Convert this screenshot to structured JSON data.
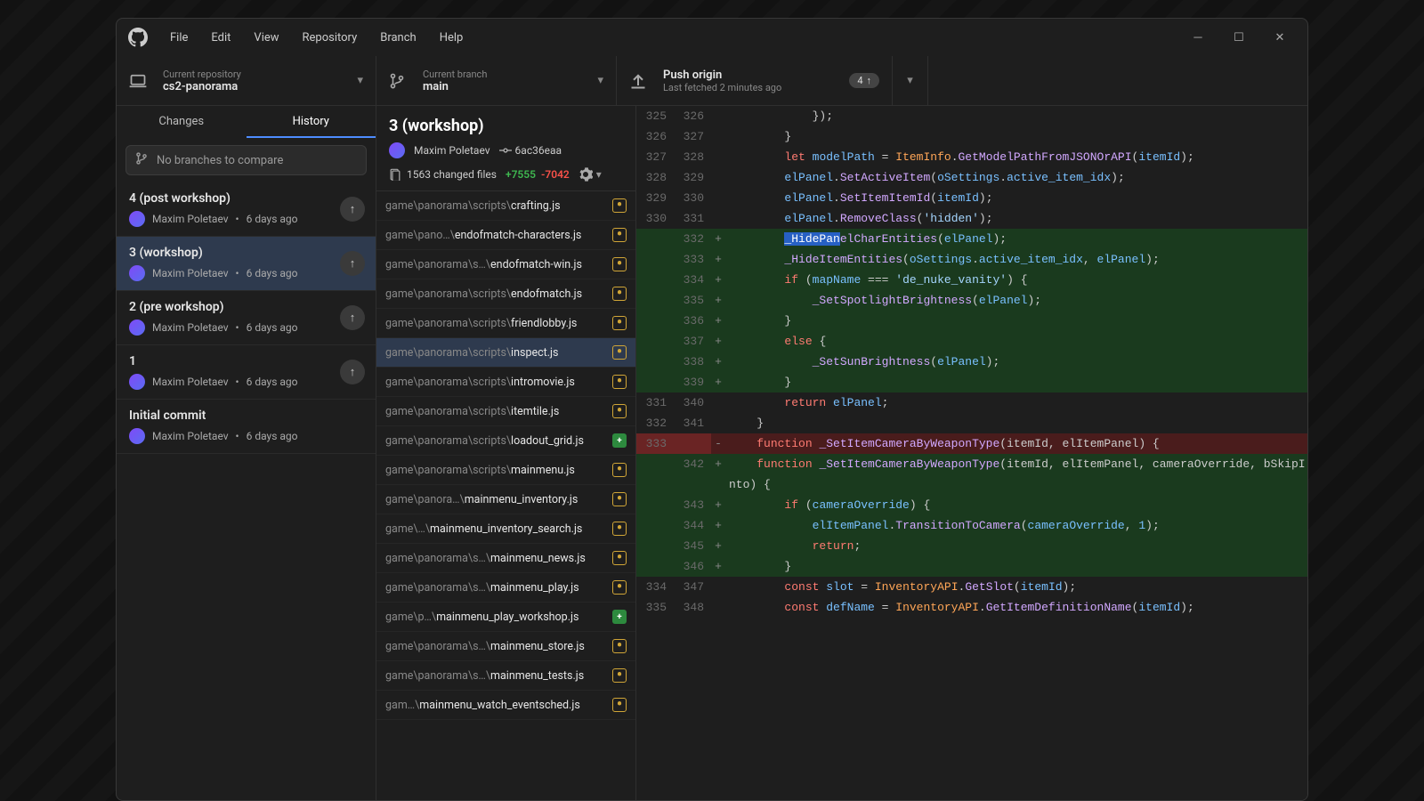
{
  "menus": {
    "file": "File",
    "edit": "Edit",
    "view": "View",
    "repository": "Repository",
    "branch": "Branch",
    "help": "Help"
  },
  "repo": {
    "label": "Current repository",
    "name": "cs2-panorama"
  },
  "branch": {
    "label": "Current branch",
    "name": "main"
  },
  "push": {
    "label": "Push origin",
    "sub": "Last fetched 2 minutes ago",
    "badge": "4"
  },
  "tabs": {
    "changes": "Changes",
    "history": "History"
  },
  "compare_placeholder": "No branches to compare",
  "commits": [
    {
      "title": "4 (post workshop)",
      "author": "Maxim Poletaev",
      "time": "6 days ago",
      "hasUp": true
    },
    {
      "title": "3 (workshop)",
      "author": "Maxim Poletaev",
      "time": "6 days ago",
      "hasUp": true
    },
    {
      "title": "2 (pre workshop)",
      "author": "Maxim Poletaev",
      "time": "6 days ago",
      "hasUp": true
    },
    {
      "title": "1",
      "author": "Maxim Poletaev",
      "time": "6 days ago",
      "hasUp": true
    },
    {
      "title": "Initial commit",
      "author": "Maxim Poletaev",
      "time": "6 days ago",
      "hasUp": false
    }
  ],
  "commit_header": {
    "title": "3 (workshop)",
    "author": "Maxim Poletaev",
    "sha": "6ac36eaa",
    "changed": "1563 changed files",
    "add": "+7555",
    "del": "-7042"
  },
  "files": [
    {
      "pre": "game\\panorama\\scripts\\",
      "name": "crafting.js",
      "t": "mod"
    },
    {
      "pre": "game\\pano…\\",
      "name": "endofmatch-characters.js",
      "t": "mod"
    },
    {
      "pre": "game\\panorama\\s…\\",
      "name": "endofmatch-win.js",
      "t": "mod"
    },
    {
      "pre": "game\\panorama\\scripts\\",
      "name": "endofmatch.js",
      "t": "mod"
    },
    {
      "pre": "game\\panorama\\scripts\\",
      "name": "friendlobby.js",
      "t": "mod"
    },
    {
      "pre": "game\\panorama\\scripts\\",
      "name": "inspect.js",
      "t": "mod"
    },
    {
      "pre": "game\\panorama\\scripts\\",
      "name": "intromovie.js",
      "t": "mod"
    },
    {
      "pre": "game\\panorama\\scripts\\",
      "name": "itemtile.js",
      "t": "mod"
    },
    {
      "pre": "game\\panorama\\scripts\\",
      "name": "loadout_grid.js",
      "t": "add"
    },
    {
      "pre": "game\\panorama\\scripts\\",
      "name": "mainmenu.js",
      "t": "mod"
    },
    {
      "pre": "game\\panora…\\",
      "name": "mainmenu_inventory.js",
      "t": "mod"
    },
    {
      "pre": "game\\…\\",
      "name": "mainmenu_inventory_search.js",
      "t": "mod"
    },
    {
      "pre": "game\\panorama\\s…\\",
      "name": "mainmenu_news.js",
      "t": "mod"
    },
    {
      "pre": "game\\panorama\\s…\\",
      "name": "mainmenu_play.js",
      "t": "mod"
    },
    {
      "pre": "game\\p…\\",
      "name": "mainmenu_play_workshop.js",
      "t": "add"
    },
    {
      "pre": "game\\panorama\\s…\\",
      "name": "mainmenu_store.js",
      "t": "mod"
    },
    {
      "pre": "game\\panorama\\s…\\",
      "name": "mainmenu_tests.js",
      "t": "mod"
    },
    {
      "pre": "gam…\\",
      "name": "mainmenu_watch_eventsched.js",
      "t": "mod"
    }
  ],
  "diff": [
    {
      "o": "325",
      "n": "326",
      "m": "",
      "t": "ctx",
      "html": "            });"
    },
    {
      "o": "326",
      "n": "327",
      "m": "",
      "t": "ctx",
      "html": "        }"
    },
    {
      "o": "327",
      "n": "328",
      "m": "",
      "t": "ctx",
      "html": "        <span class='c-k'>let</span> <span class='c-v'>modelPath</span> = <span class='c-t'>ItemInfo</span>.<span class='c-f'>GetModelPathFromJSONOrAPI</span>(<span class='c-v'>itemId</span>);"
    },
    {
      "o": "328",
      "n": "329",
      "m": "",
      "t": "ctx",
      "html": "        <span class='c-v'>elPanel</span>.<span class='c-f'>SetActiveItem</span>(<span class='c-v'>oSettings</span>.<span class='c-v'>active_item_idx</span>);"
    },
    {
      "o": "329",
      "n": "330",
      "m": "",
      "t": "ctx",
      "html": "        <span class='c-v'>elPanel</span>.<span class='c-f'>SetItemItemId</span>(<span class='c-v'>itemId</span>);"
    },
    {
      "o": "330",
      "n": "331",
      "m": "",
      "t": "ctx",
      "html": "        <span class='c-v'>elPanel</span>.<span class='c-f'>RemoveClass</span>(<span class='c-s'>'hidden'</span>);"
    },
    {
      "o": "",
      "n": "332",
      "m": "+",
      "t": "added hl",
      "html": "        <span class='selmark'>_HidePan</span><span class='c-f'>elCharEntities</span>(<span class='c-v'>elPanel</span>);"
    },
    {
      "o": "",
      "n": "333",
      "m": "+",
      "t": "added",
      "html": "        <span class='c-f'>_HideItemEntities</span>(<span class='c-v'>oSettings</span>.<span class='c-v'>active_item_idx</span>, <span class='c-v'>elPanel</span>);"
    },
    {
      "o": "",
      "n": "334",
      "m": "+",
      "t": "added",
      "html": "        <span class='c-k'>if</span> (<span class='c-v'>mapName</span> === <span class='c-s'>'de_nuke_vanity'</span>) {"
    },
    {
      "o": "",
      "n": "335",
      "m": "+",
      "t": "added",
      "html": "            <span class='c-f'>_SetSpotlightBrightness</span>(<span class='c-v'>elPanel</span>);"
    },
    {
      "o": "",
      "n": "336",
      "m": "+",
      "t": "added",
      "html": "        }"
    },
    {
      "o": "",
      "n": "337",
      "m": "+",
      "t": "added",
      "html": "        <span class='c-k'>else</span> {"
    },
    {
      "o": "",
      "n": "338",
      "m": "+",
      "t": "added",
      "html": "            <span class='c-f'>_SetSunBrightness</span>(<span class='c-v'>elPanel</span>);"
    },
    {
      "o": "",
      "n": "339",
      "m": "+",
      "t": "added",
      "html": "        }"
    },
    {
      "o": "331",
      "n": "340",
      "m": "",
      "t": "ctx",
      "html": "        <span class='c-k'>return</span> <span class='c-v'>elPanel</span>;"
    },
    {
      "o": "332",
      "n": "341",
      "m": "",
      "t": "ctx",
      "html": "    }"
    },
    {
      "o": "333",
      "n": "",
      "m": "-",
      "t": "removed hl",
      "html": "    <span class='c-k'>function</span> <span class='c-f'>_SetItemCameraByWeaponType</span>(itemId, elItemPanel) {"
    },
    {
      "o": "",
      "n": "342",
      "m": "+",
      "t": "added",
      "html": "    <span class='c-k'>function</span> <span class='c-f'>_SetItemCameraByWeaponType</span>(itemId, elItemPanel, cameraOverride, bSkipI"
    },
    {
      "o": "",
      "n": "",
      "m": "",
      "t": "added",
      "html": "nto) {"
    },
    {
      "o": "",
      "n": "343",
      "m": "+",
      "t": "added",
      "html": "        <span class='c-k'>if</span> (<span class='c-v'>cameraOverride</span>) {"
    },
    {
      "o": "",
      "n": "344",
      "m": "+",
      "t": "added",
      "html": "            <span class='c-v'>elItemPanel</span>.<span class='c-f'>TransitionToCamera</span>(<span class='c-v'>cameraOverride</span>, <span class='c-v'>1</span>);"
    },
    {
      "o": "",
      "n": "345",
      "m": "+",
      "t": "added",
      "html": "            <span class='c-k'>return</span>;"
    },
    {
      "o": "",
      "n": "346",
      "m": "+",
      "t": "added",
      "html": "        }"
    },
    {
      "o": "334",
      "n": "347",
      "m": "",
      "t": "ctx",
      "html": "        <span class='c-k'>const</span> <span class='c-v'>slot</span> = <span class='c-t'>InventoryAPI</span>.<span class='c-f'>GetSlot</span>(<span class='c-v'>itemId</span>);"
    },
    {
      "o": "335",
      "n": "348",
      "m": "",
      "t": "ctx",
      "html": "        <span class='c-k'>const</span> <span class='c-v'>defName</span> = <span class='c-t'>InventoryAPI</span>.<span class='c-f'>GetItemDefinitionName</span>(<span class='c-v'>itemId</span>);"
    }
  ]
}
